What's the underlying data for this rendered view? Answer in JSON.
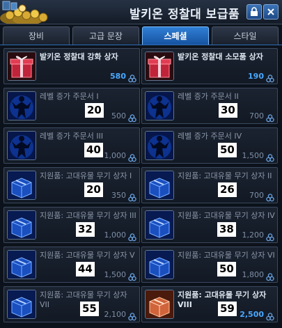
{
  "title": "발키온 정찰대 보급품",
  "tabs": [
    "장비",
    "고급 문장",
    "스페셜",
    "스타일"
  ],
  "active_tab": 2,
  "items": [
    {
      "name": "발키온 정찰대 강화 상자",
      "price": "580",
      "icon": "red-gift-box-icon",
      "overlay": ""
    },
    {
      "name": "발키온 정찰대 소모품 상자",
      "price": "190",
      "icon": "red-gift-box-icon",
      "overlay": ""
    },
    {
      "name": "레벨 증가 주문서 I",
      "price": "500",
      "icon": "blue-figure-scroll-icon",
      "overlay": "20"
    },
    {
      "name": "레벨 증가 주문서 II",
      "price": "700",
      "icon": "blue-figure-scroll-icon",
      "overlay": "30"
    },
    {
      "name": "레벨 증가 주문서 III",
      "price": "1,000",
      "icon": "blue-figure-scroll-icon",
      "overlay": "40"
    },
    {
      "name": "레벨 증가 주문서 IV",
      "price": "1,500",
      "icon": "blue-figure-scroll-icon",
      "overlay": "50"
    },
    {
      "name": "지원품: 고대유물 무기 상자 I",
      "price": "350",
      "icon": "blue-supply-box-icon",
      "overlay": "20"
    },
    {
      "name": "지원품: 고대유물 무기 상자 II",
      "price": "700",
      "icon": "blue-supply-box-icon",
      "overlay": "26"
    },
    {
      "name": "지원품: 고대유물 무기 상자 III",
      "price": "1,000",
      "icon": "blue-supply-box-icon",
      "overlay": "32"
    },
    {
      "name": "지원품: 고대유물 무기 상자 IV",
      "price": "1,200",
      "icon": "blue-supply-box-icon",
      "overlay": "38"
    },
    {
      "name": "지원품: 고대유물 무기 상자 V",
      "price": "1,500",
      "icon": "blue-supply-box-icon",
      "overlay": "44"
    },
    {
      "name": "지원품: 고대유물 무기 상자 VI",
      "price": "1,800",
      "icon": "blue-supply-box-icon",
      "overlay": "50"
    },
    {
      "name": "지원품: 고대유물 무기 상자 VII",
      "price": "2,100",
      "icon": "blue-supply-box-icon",
      "overlay": "55"
    },
    {
      "name": "지원품: 고대유물 무기 상자 VIII",
      "price": "2,500",
      "icon": "orange-supply-box-icon",
      "overlay": "59"
    }
  ],
  "colors": {
    "accent": "#2f7fd6",
    "price_bright": "#4aa8ff",
    "price_dim": "#7f8fa6"
  }
}
